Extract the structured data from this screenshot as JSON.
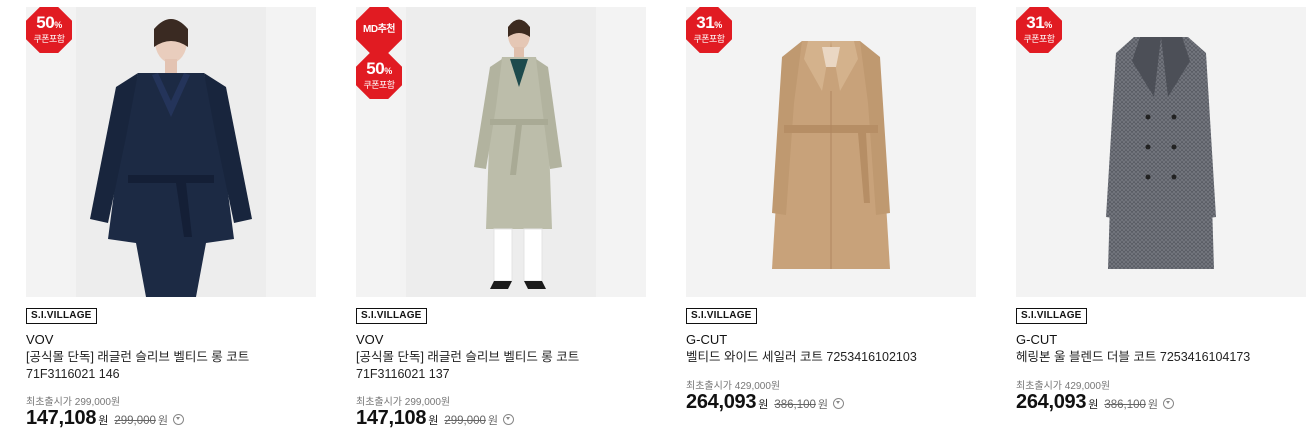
{
  "colors": {
    "badge_red": "#e11b22",
    "text": "#111111",
    "muted": "#777777"
  },
  "products": [
    {
      "badges": [
        {
          "type": "discount",
          "pct": "50",
          "pct_unit": "%",
          "sub": "쿠폰포함"
        }
      ],
      "brand_tag": "S.I.VILLAGE",
      "brand": "VOV",
      "name": "[공식몰 단독] 래글런 슬리브 벨티드 롱 코트 71F3116021 146",
      "orig_label": "최초출시가 299,000원",
      "price": "147,108",
      "currency": "원",
      "strike_price": "299,000",
      "strike_currency": "원",
      "image_icon": "navy-trench-coat-image"
    },
    {
      "badges": [
        {
          "type": "md",
          "text": "MD추천"
        },
        {
          "type": "discount",
          "pct": "50",
          "pct_unit": "%",
          "sub": "쿠폰포함"
        }
      ],
      "brand_tag": "S.I.VILLAGE",
      "brand": "VOV",
      "name": "[공식몰 단독] 래글런 슬리브 벨티드 롱 코트 71F3116021 137",
      "orig_label": "최초출시가 299,000원",
      "price": "147,108",
      "currency": "원",
      "strike_price": "299,000",
      "strike_currency": "원",
      "image_icon": "beige-trench-coat-image"
    },
    {
      "badges": [
        {
          "type": "discount",
          "pct": "31",
          "pct_unit": "%",
          "sub": "쿠폰포함"
        }
      ],
      "brand_tag": "S.I.VILLAGE",
      "brand": "G-CUT",
      "name": "벨티드 와이드 세일러 코트 7253416102103",
      "orig_label": "최초출시가 429,000원",
      "price": "264,093",
      "currency": "원",
      "strike_price": "386,100",
      "strike_currency": "원",
      "image_icon": "camel-coat-image"
    },
    {
      "badges": [
        {
          "type": "discount",
          "pct": "31",
          "pct_unit": "%",
          "sub": "쿠폰포함"
        }
      ],
      "brand_tag": "S.I.VILLAGE",
      "brand": "G-CUT",
      "name": "헤링본 울 블렌드 더블 코트 7253416104173",
      "orig_label": "최초출시가 429,000원",
      "price": "264,093",
      "currency": "원",
      "strike_price": "386,100",
      "strike_currency": "원",
      "image_icon": "gray-herringbone-coat-image"
    }
  ]
}
